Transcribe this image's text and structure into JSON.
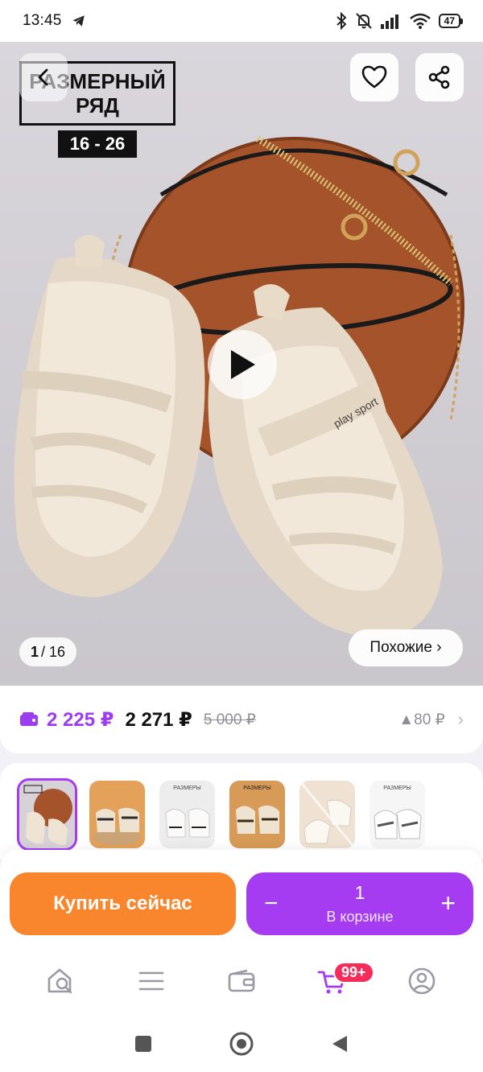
{
  "status_bar": {
    "time": "13:45",
    "battery": "47"
  },
  "hero": {
    "size_badge_line1": "РАЗМЕРНЫЙ",
    "size_badge_line2": "РЯД",
    "size_range": "16 - 26",
    "shoe_print": "play sport",
    "counter_current": "1",
    "counter_total": "/ 16",
    "similar_label": "Похожие ›"
  },
  "price": {
    "wallet_price": "2 225 ₽",
    "main_price": "2 271 ₽",
    "old_price": "5 000 ₽",
    "drop": "▲80 ₽"
  },
  "thumbnails": [
    {
      "label": ""
    },
    {
      "label": ""
    },
    {
      "label": "РАЗМЕРЫ"
    },
    {
      "label": "РАЗМЕРЫ"
    },
    {
      "label": ""
    },
    {
      "label": "РАЗМЕРЫ"
    }
  ],
  "actions": {
    "buy_now": "Купить сейчас",
    "quantity": "1",
    "in_cart": "В корзине"
  },
  "nav": {
    "cart_badge": "99+"
  },
  "colors": {
    "accent_purple": "#a53cf2",
    "buy_orange": "#f9852c",
    "badge_red": "#f52b5a",
    "wallet_purple": "#9e3cf0"
  }
}
